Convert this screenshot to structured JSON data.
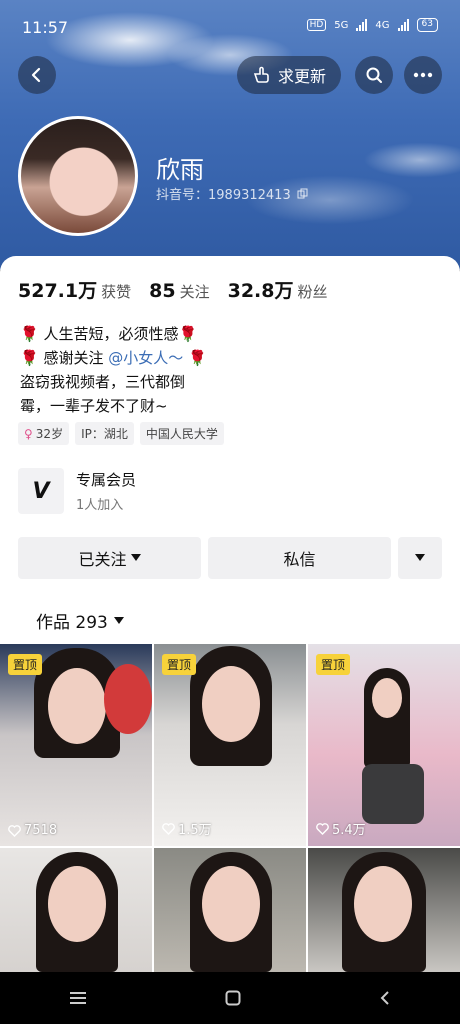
{
  "status_bar": {
    "time": "11:57",
    "hd": "HD",
    "net1": "5G",
    "net2": "4G",
    "battery": "63"
  },
  "header": {
    "request_update_label": "求更新",
    "icons": [
      "back-icon",
      "thumb-point-icon",
      "search-icon",
      "more-icon"
    ]
  },
  "profile": {
    "nickname": "欣雨",
    "douyin_id": "抖音号：1989312413"
  },
  "stats": [
    {
      "value": "527.1万",
      "label": "获赞"
    },
    {
      "value": "85",
      "label": "关注"
    },
    {
      "value": "32.8万",
      "label": "粉丝"
    }
  ],
  "bio": {
    "line1": "人生苦短，必须性感",
    "line2_prefix": "感谢关注 ",
    "line2_mention": "@小女人～",
    "line3": "盗窃我视频者，三代都倒",
    "line4": "霉，一辈子发不了财~",
    "rose": "🌹"
  },
  "tags": {
    "age": "32岁",
    "ip": "IP：湖北",
    "school": "中国人民大学"
  },
  "member": {
    "title": "专属会员",
    "subtitle": "1人加入"
  },
  "actions": {
    "followed": "已关注",
    "message": "私信"
  },
  "works": {
    "label": "作品 293"
  },
  "videos": [
    {
      "pinned": "置顶",
      "likes": "7518"
    },
    {
      "pinned": "置顶",
      "likes": "1.5万"
    },
    {
      "pinned": "置顶",
      "likes": "5.4万"
    },
    {
      "pinned": "",
      "likes": ""
    },
    {
      "pinned": "",
      "likes": ""
    },
    {
      "pinned": "",
      "likes": ""
    }
  ]
}
